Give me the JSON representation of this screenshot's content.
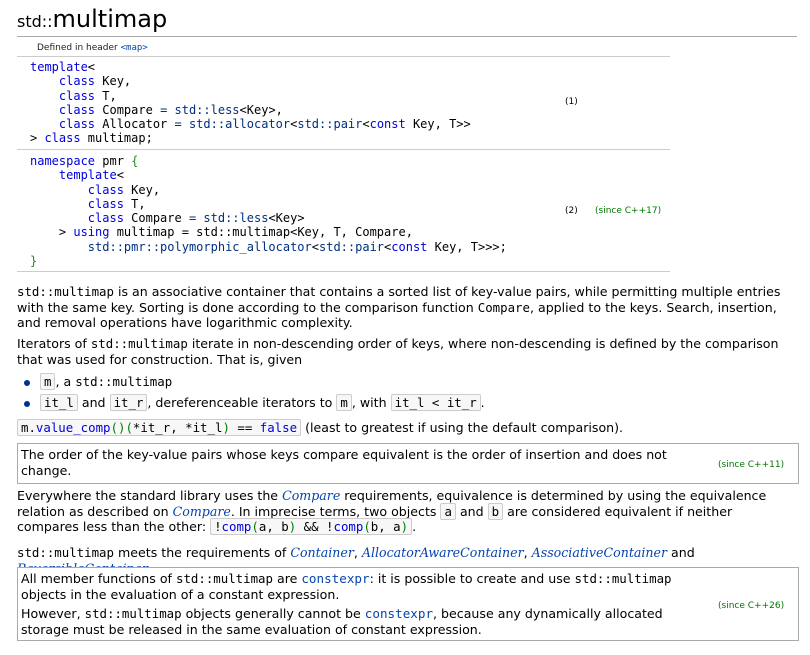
{
  "title": {
    "namespace": "std::",
    "name": "multimap"
  },
  "header": {
    "label": "Defined in header",
    "header_name": "<map>"
  },
  "declarations": [
    {
      "number": "(1)",
      "since": ""
    },
    {
      "number": "(2)",
      "since": "(since C++17)"
    }
  ],
  "description": {
    "p1_code": "std::multimap",
    "p1_text_a": " is an associative container that contains a sorted list of key-value pairs, while permitting multiple entries with the same key. Sorting is done according to the comparison function ",
    "p1_code2": "Compare",
    "p1_text_b": ", applied to the keys. Search, insertion, and removal operations have logarithmic complexity.",
    "p2_text_a": "Iterators of ",
    "p2_code": "std::multimap",
    "p2_text_b": " iterate in non-descending order of keys, where non-descending is defined by the comparison that was used for construction. That is, given",
    "bullet1_code_a": "m",
    "bullet1_text": ", a ",
    "bullet1_code_b": "std::multimap",
    "bullet2_code_a": "it_l",
    "bullet2_and": "and",
    "bullet2_code_b": "it_r",
    "bullet2_text": ", dereferenceable iterators to ",
    "bullet2_code_c": "m",
    "bullet2_with": ", with",
    "bullet2_code_d": "it_l < it_r",
    "bullet2_end": ".",
    "expr_text": "(least to greatest if using the default comparison)."
  },
  "note_order": {
    "text": "The order of the key-value pairs whose keys compare equivalent is the order of insertion and does not change.",
    "since": "(since C++11)"
  },
  "equivalence": {
    "text_a": "Everywhere the standard library uses the ",
    "link_a": "Compare",
    "text_b": " requirements, equivalence is determined by using the equivalence relation as described on ",
    "link_b": "Compare",
    "text_c": ". In imprecise terms, two objects ",
    "code_a": "a",
    "and": "and",
    "code_b": "b",
    "text_d": " are considered equivalent if neither compares less than the other: "
  },
  "requirements": {
    "code": "std::multimap",
    "text_a": " meets the requirements of ",
    "link_a": "Container",
    "sep_a": ", ",
    "link_b": "AllocatorAwareContainer",
    "sep_b": ", ",
    "link_c": "AssociativeContainer",
    "and": " and ",
    "link_d": "ReversibleContainer",
    "end": "."
  },
  "note_constexpr": {
    "p1_text_a": "All member functions of ",
    "p1_code": "std::multimap",
    "p1_text_b": " are ",
    "p1_link": "constexpr",
    "p1_text_c": ": it is possible to create and use ",
    "p1_code2": "std::multimap",
    "p1_text_d": " objects in the evaluation of a constant expression.",
    "p2_text_a": "However, ",
    "p2_code": "std::multimap",
    "p2_text_b": " objects generally cannot be ",
    "p2_link": "constexpr",
    "p2_text_c": ", because any dynamically allocated storage must be released in the same evaluation of constant expression.",
    "since": "(since C++26)"
  }
}
